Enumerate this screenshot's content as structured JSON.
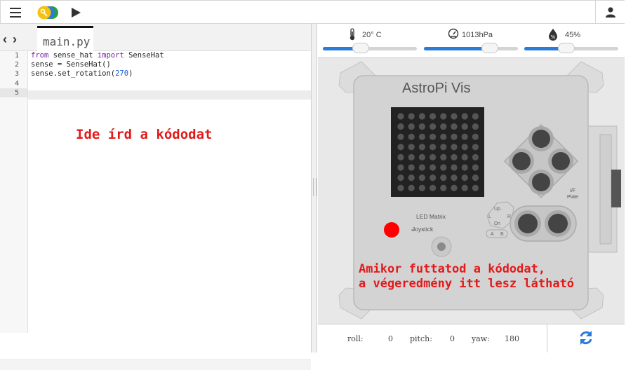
{
  "toolbar": {
    "menu_icon": "hamburger-menu-icon",
    "logo_icon": "trinket-logo-icon",
    "run_icon": "play-icon",
    "user_icon": "user-icon"
  },
  "editor": {
    "tab_label": "main.py",
    "line_numbers": [
      "1",
      "2",
      "3",
      "4",
      "5"
    ],
    "code": {
      "l1_kw1": "from",
      "l1_mid": " sense_hat ",
      "l1_kw2": "import",
      "l1_end": " SenseHat",
      "l2": "sense = SenseHat()",
      "l3_start": "sense.set_rotation(",
      "l3_num": "270",
      "l3_end": ")"
    },
    "hint": "Ide írd a kódodat"
  },
  "sensors": {
    "temperature": {
      "label": "20° C",
      "icon": "thermometer-icon",
      "level": 0.4
    },
    "pressure": {
      "label": "1013hPa",
      "icon": "gauge-icon",
      "level": 0.7
    },
    "humidity": {
      "label": "45%",
      "icon": "humidity-icon",
      "level": 0.45
    }
  },
  "board": {
    "title": "AstroPi Vis",
    "led_label": "LED Matrix",
    "joystick_label": "Joystick",
    "button_up": "Up",
    "button_dn": "Dn",
    "button_l": "L",
    "button_r": "R",
    "button_a": "A",
    "button_b": "B",
    "plate_label_1": "I/F",
    "plate_label_2": "Plate"
  },
  "output_hint": "Amikor futtatod a kódodat,\na végeredmény itt lesz látható",
  "orientation": {
    "roll_label": "roll:",
    "roll_value": "0",
    "pitch_label": "pitch:",
    "pitch_value": "0",
    "yaw_label": "yaw:",
    "yaw_value": "180",
    "refresh_icon": "refresh-icon"
  },
  "colors": {
    "accent": "#2b7bd8",
    "hint": "#e21a1a",
    "status_led": "#ff0000"
  }
}
